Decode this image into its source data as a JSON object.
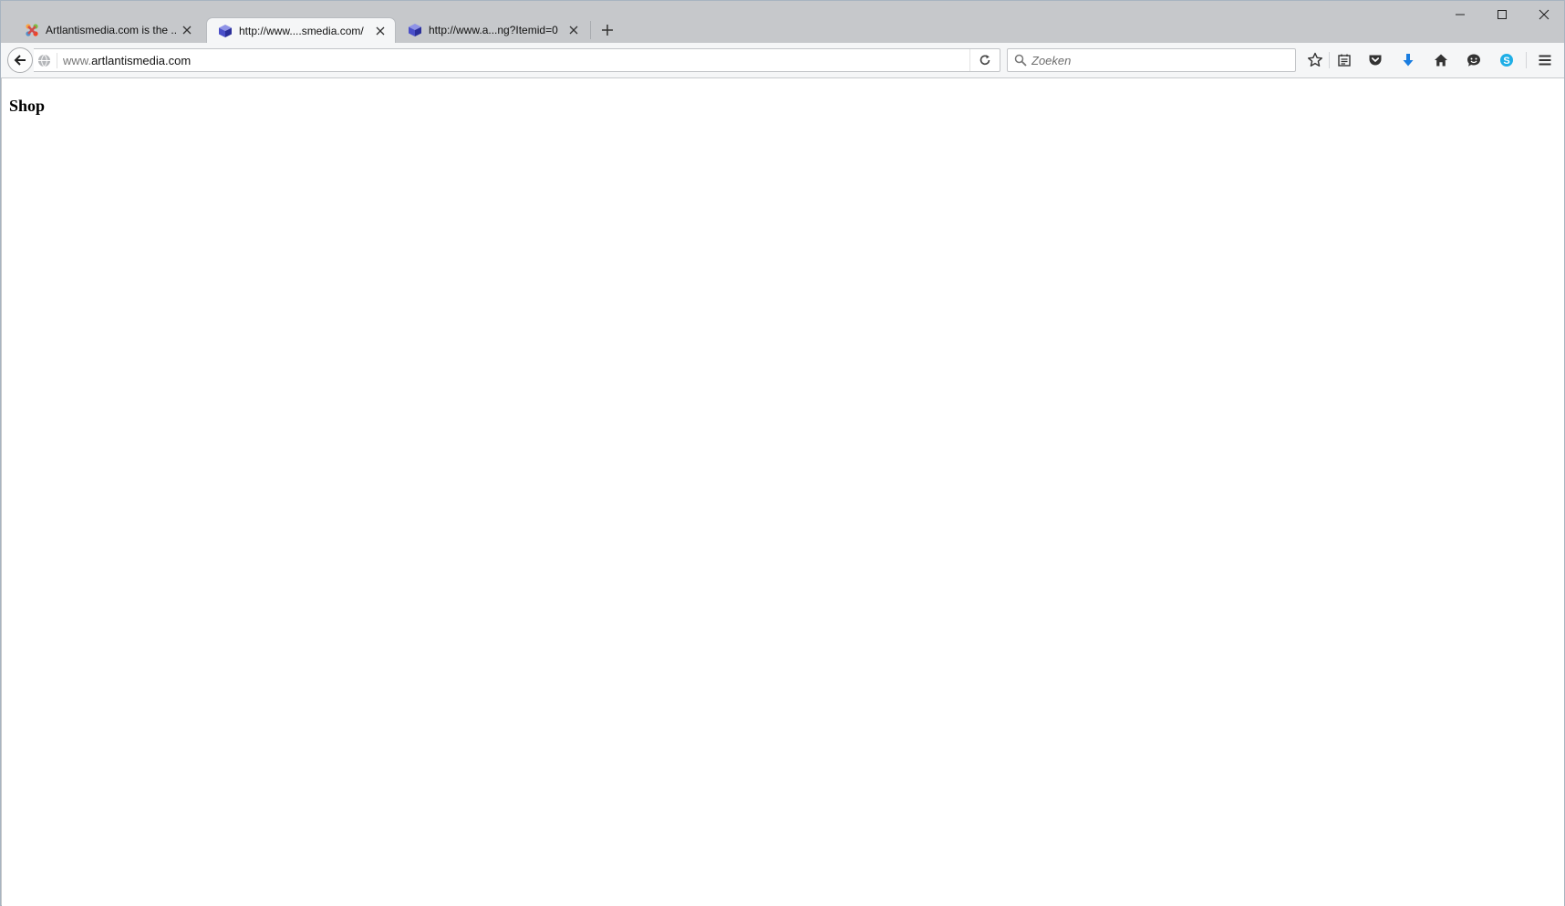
{
  "browser": {
    "tabs": [
      {
        "title": "Artlantismedia.com is the ...",
        "favicon": "joomla-icon",
        "active": false
      },
      {
        "title": "http://www....smedia.com/",
        "favicon": "cube-icon",
        "active": true
      },
      {
        "title": "http://www.a...ng?Itemid=0",
        "favicon": "cube-icon",
        "active": false
      }
    ],
    "url": {
      "prefix": "www.",
      "domain": "artlantismedia.com"
    },
    "search": {
      "placeholder": "Zoeken",
      "value": ""
    },
    "toolbar_icons": [
      "star-icon",
      "reading-list-icon",
      "pocket-icon",
      "download-icon",
      "home-icon",
      "chat-icon",
      "skype-icon",
      "menu-icon"
    ],
    "colors": {
      "accent_download": "#1a7de0",
      "skype": "#1eaee6",
      "cube": "#4a4fc9"
    }
  },
  "page": {
    "heading": "Shop"
  }
}
